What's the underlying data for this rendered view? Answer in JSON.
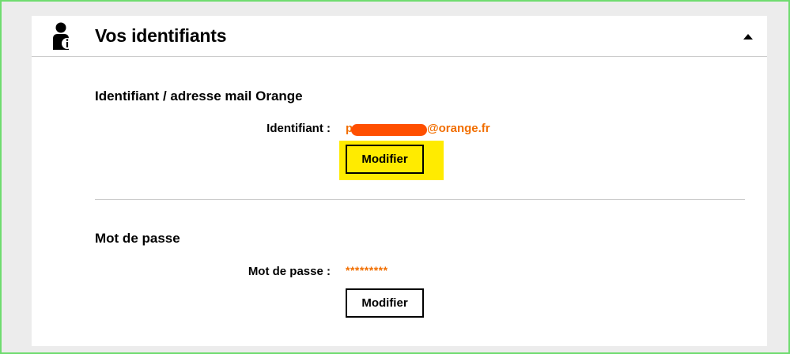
{
  "panel": {
    "title": "Vos identifiants",
    "icon": "user-info-icon",
    "toggle_icon": "caret-up-icon"
  },
  "identifiant_section": {
    "title": "Identifiant / adresse mail Orange",
    "label": "Identifiant :",
    "value_prefix": "p",
    "value_suffix": "@orange.fr",
    "button_label": "Modifier"
  },
  "password_section": {
    "title": "Mot de passe",
    "label": "Mot de passe :",
    "value": "*********",
    "button_label": "Modifier"
  },
  "colors": {
    "accent_orange": "#f16e00",
    "redaction": "#ff4f00",
    "highlight_yellow": "#ffeb00",
    "frame_border": "#6fdc6f"
  }
}
